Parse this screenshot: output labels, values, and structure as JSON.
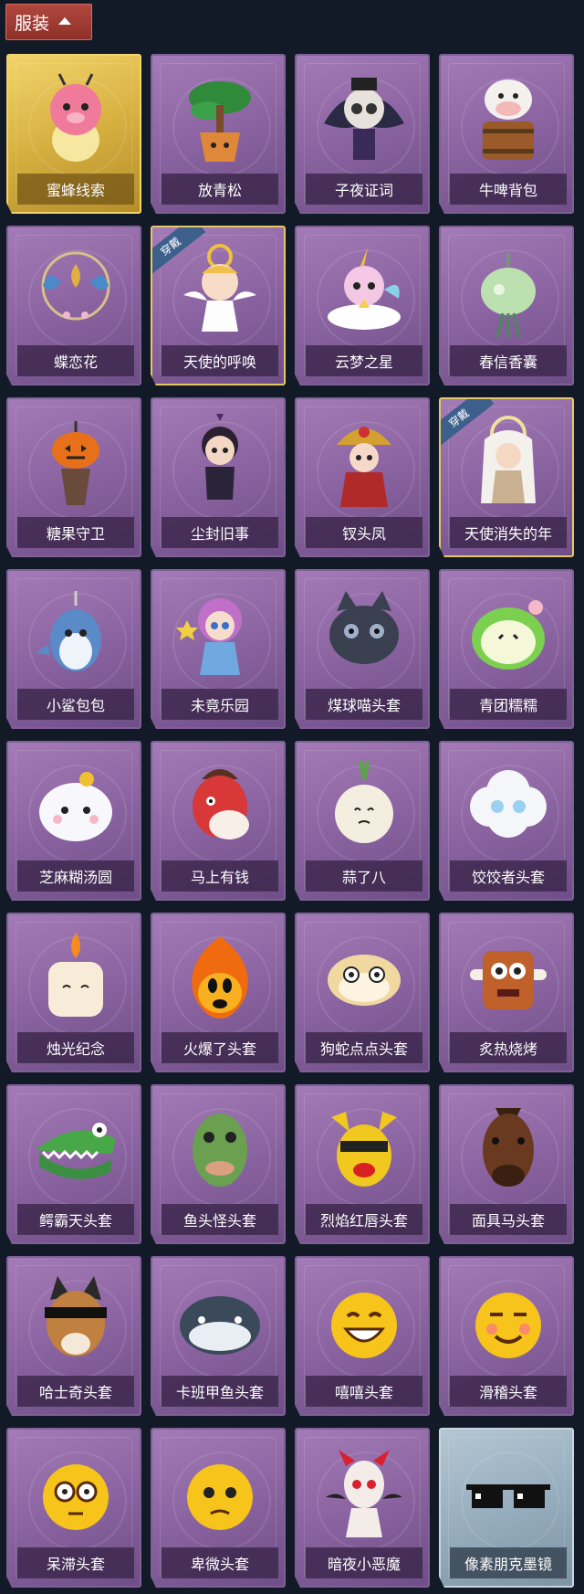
{
  "header": {
    "label": "服装"
  },
  "items": [
    {
      "name": "蜜蜂线索",
      "style": "gold",
      "icon": "bee-doll-icon",
      "worn": false
    },
    {
      "name": "放青松",
      "style": "purple",
      "icon": "pine-bonsai-icon",
      "worn": false
    },
    {
      "name": "子夜证词",
      "style": "purple",
      "icon": "owl-figure-icon",
      "worn": false
    },
    {
      "name": "牛啤背包",
      "style": "purple",
      "icon": "cow-barrel-icon",
      "worn": false
    },
    {
      "name": "蝶恋花",
      "style": "purple",
      "icon": "butterfly-ornament-icon",
      "worn": false
    },
    {
      "name": "天使的呼唤",
      "style": "purple",
      "icon": "angel-figure-icon",
      "worn": true,
      "badge": "穿戴"
    },
    {
      "name": "云梦之星",
      "style": "purple",
      "icon": "unicorn-cloud-icon",
      "worn": false
    },
    {
      "name": "春信香囊",
      "style": "purple",
      "icon": "sachet-icon",
      "worn": false
    },
    {
      "name": "糖果守卫",
      "style": "purple",
      "icon": "pumpkin-icon",
      "worn": false
    },
    {
      "name": "尘封旧事",
      "style": "purple",
      "icon": "boy-figure-icon",
      "worn": false
    },
    {
      "name": "钗头凤",
      "style": "purple",
      "icon": "phoenix-crown-icon",
      "worn": false
    },
    {
      "name": "天使消失的年",
      "style": "purple",
      "icon": "veiled-girl-icon",
      "worn": true,
      "badge": "穿戴"
    },
    {
      "name": "小鲨包包",
      "style": "purple",
      "icon": "shark-bag-icon",
      "worn": false
    },
    {
      "name": "未竟乐园",
      "style": "purple",
      "icon": "magical-girl-icon",
      "worn": false
    },
    {
      "name": "煤球喵头套",
      "style": "purple",
      "icon": "black-cat-icon",
      "worn": false
    },
    {
      "name": "青团糯糯",
      "style": "purple",
      "icon": "green-dumpling-icon",
      "worn": false
    },
    {
      "name": "芝麻糊汤圆",
      "style": "purple",
      "icon": "rice-ball-icon",
      "worn": false
    },
    {
      "name": "马上有钱",
      "style": "purple",
      "icon": "red-horse-icon",
      "worn": false
    },
    {
      "name": "蒜了八",
      "style": "purple",
      "icon": "garlic-icon",
      "worn": false
    },
    {
      "name": "饺饺者头套",
      "style": "purple",
      "icon": "dumpling-cloud-icon",
      "worn": false
    },
    {
      "name": "烛光纪念",
      "style": "purple",
      "icon": "candle-icon",
      "worn": false
    },
    {
      "name": "火爆了头套",
      "style": "purple",
      "icon": "fire-icon",
      "worn": false
    },
    {
      "name": "狗蛇点点头套",
      "style": "purple",
      "icon": "dog-snake-icon",
      "worn": false
    },
    {
      "name": "炙热烧烤",
      "style": "purple",
      "icon": "bbq-meat-icon",
      "worn": false
    },
    {
      "name": "鳄霸天头套",
      "style": "purple",
      "icon": "crocodile-icon",
      "worn": false
    },
    {
      "name": "鱼头怪头套",
      "style": "purple",
      "icon": "fish-head-icon",
      "worn": false
    },
    {
      "name": "烈焰红唇头套",
      "style": "purple",
      "icon": "yellow-mascot-icon",
      "worn": false
    },
    {
      "name": "面具马头套",
      "style": "purple",
      "icon": "horse-mask-icon",
      "worn": false
    },
    {
      "name": "哈士奇头套",
      "style": "purple",
      "icon": "husky-icon",
      "worn": false
    },
    {
      "name": "卡班甲鱼头套",
      "style": "purple",
      "icon": "whale-head-icon",
      "worn": false
    },
    {
      "name": "嘻嘻头套",
      "style": "purple",
      "icon": "grin-emoji-icon",
      "worn": false
    },
    {
      "name": "滑稽头套",
      "style": "purple",
      "icon": "funny-emoji-icon",
      "worn": false
    },
    {
      "name": "呆滞头套",
      "style": "purple",
      "icon": "stare-emoji-icon",
      "worn": false
    },
    {
      "name": "卑微头套",
      "style": "purple",
      "icon": "humble-emoji-icon",
      "worn": false
    },
    {
      "name": "暗夜小恶魔",
      "style": "purple",
      "icon": "little-devil-icon",
      "worn": false
    },
    {
      "name": "像素朋克墨镜",
      "style": "blue",
      "icon": "pixel-sunglasses-icon",
      "worn": false
    }
  ]
}
